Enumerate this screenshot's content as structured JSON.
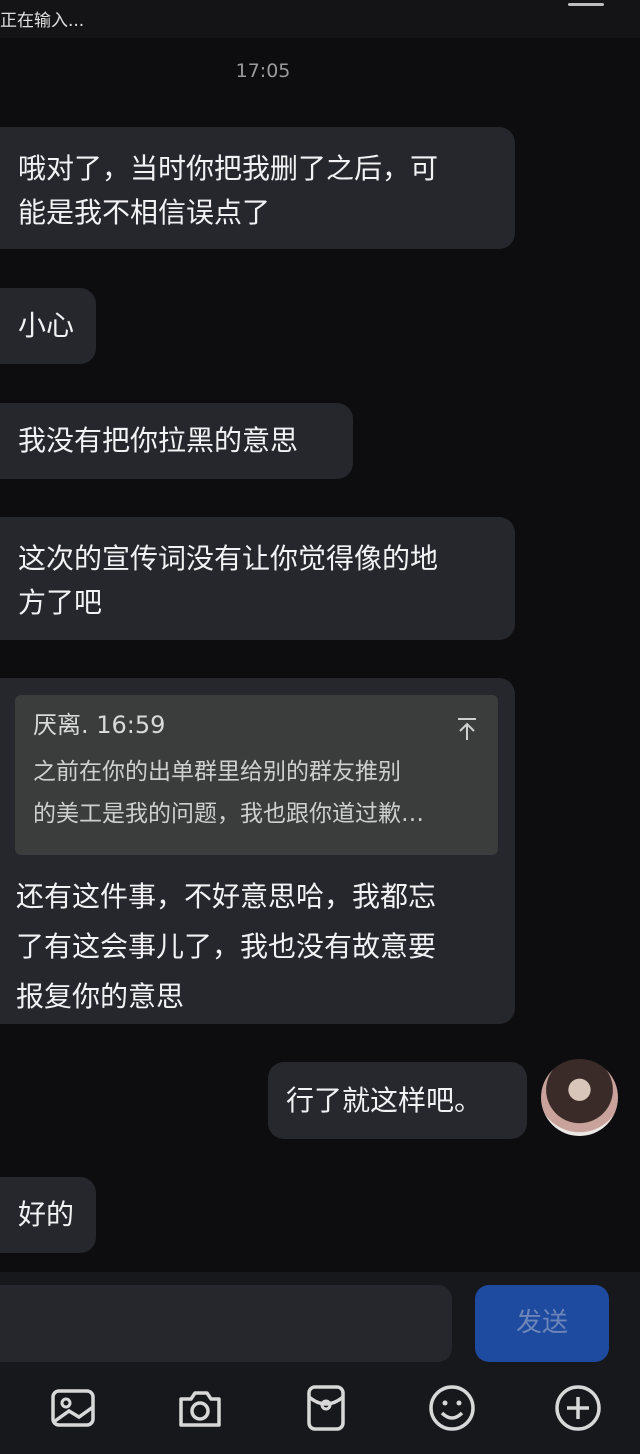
{
  "header": {
    "typing_status": "正在输入..."
  },
  "timestamp": "17:05",
  "messages": [
    {
      "side": "left",
      "line1": "哦对了，当时你把我删了之后，可",
      "line2": "能是我不相信误点了"
    },
    {
      "side": "left",
      "line1": "小心"
    },
    {
      "side": "left",
      "line1": "我没有把你拉黑的意思"
    },
    {
      "side": "left",
      "line1": "这次的宣传词没有让你觉得像的地",
      "line2": "方了吧"
    },
    {
      "side": "left",
      "quote": {
        "author_time": "厌离. 16:59",
        "line1": "之前在你的出单群里给别的群友推别",
        "line2": "的美工是我的问题，我也跟你道过歉…"
      },
      "line1": "还有这件事，不好意思哈，我都忘",
      "line2": "了有这会事儿了，我也没有故意要",
      "line3": "报复你的意思"
    },
    {
      "side": "right",
      "line1": "行了就这样吧。"
    },
    {
      "side": "left",
      "line1": "好的"
    }
  ],
  "composer": {
    "send_label": "发送"
  },
  "toolbar": {
    "icons": [
      "image-icon",
      "camera-icon",
      "red-packet-icon",
      "emoji-icon",
      "plus-icon"
    ]
  },
  "colors": {
    "background": "#0d0d0f",
    "bubble": "#26272c",
    "send_button": "#1e4aa0"
  }
}
